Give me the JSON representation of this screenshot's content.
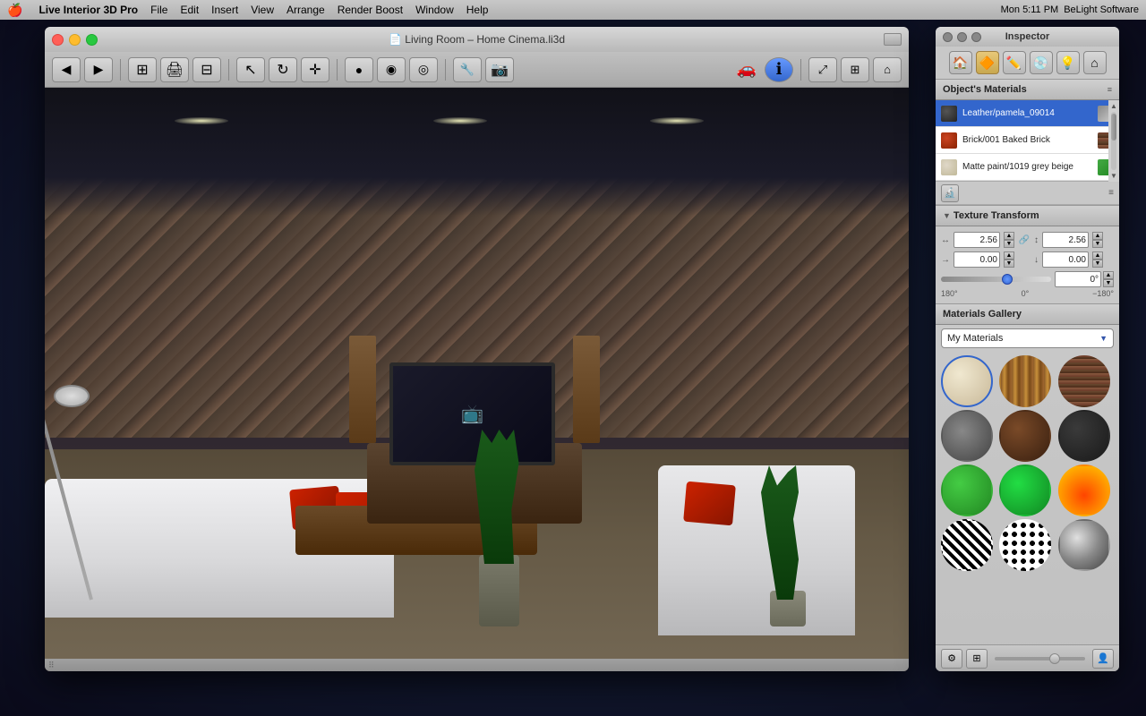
{
  "menubar": {
    "apple": "🍎",
    "items": [
      "Live Interior 3D Pro",
      "File",
      "Edit",
      "Insert",
      "View",
      "Arrange",
      "Render Boost",
      "Window",
      "Help"
    ],
    "right": {
      "time": "Mon 5:11 PM",
      "company": "BeLight Software"
    }
  },
  "window": {
    "title": "Living Room – Home Cinema.li3d",
    "close": "✕",
    "minimize": "−",
    "maximize": "+"
  },
  "inspector": {
    "title": "Inspector",
    "tabs": [
      "🏠",
      "🔶",
      "✏️",
      "💿",
      "💡",
      "🏠"
    ],
    "objects_materials_label": "Object's Materials",
    "materials": [
      {
        "name": "Leather/pamela_09014",
        "swatch_class": "mat-leather",
        "selected": true
      },
      {
        "name": "Brick/001 Baked Brick",
        "swatch_class": "mat-brick",
        "selected": false
      },
      {
        "name": "Matte paint/1019 grey beige",
        "swatch_class": "mat-matte",
        "selected": false
      }
    ],
    "texture_transform": {
      "label": "Texture Transform",
      "scale_x": "2.56",
      "scale_y": "2.56",
      "offset_x": "0.00",
      "offset_y": "0.00",
      "angle": "0°",
      "angle_min": "180°",
      "angle_mid": "0°",
      "angle_max": "−180°"
    },
    "gallery": {
      "label": "Materials Gallery",
      "dropdown": "My Materials"
    }
  }
}
